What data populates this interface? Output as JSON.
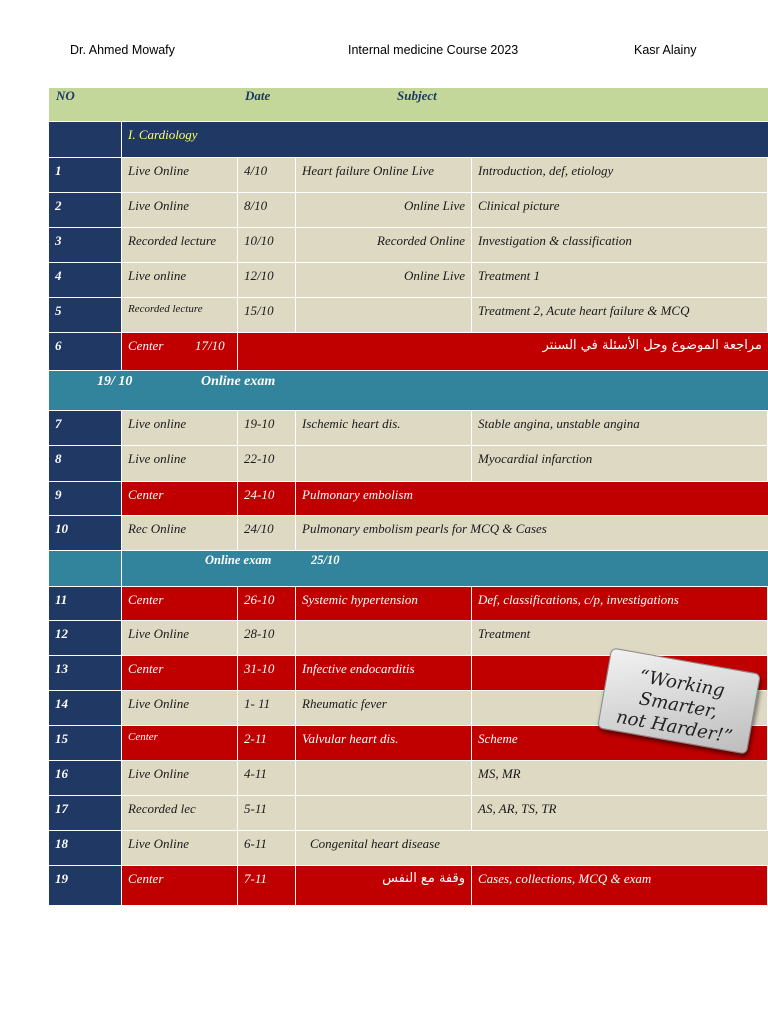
{
  "header": {
    "left": "Dr. Ahmed Mowafy",
    "center": "Internal medicine Course 2023",
    "right": "Kasr Alainy"
  },
  "table_header": {
    "no": "NO",
    "date": "Date",
    "subject": "Subject"
  },
  "cardiology_title": "I. Cardiology",
  "section1": {
    "date": "19/ 10",
    "label": "Online exam"
  },
  "section2": {
    "label": "Online exam",
    "date": "25/10"
  },
  "rows": [
    {
      "no": "1",
      "type": "Live Online",
      "date": "4/10",
      "subject": "Heart failure   Online Live",
      "desc": "Introduction, def, etiology"
    },
    {
      "no": "2",
      "type": "Live Online",
      "date": "8/10",
      "subject": "Online Live",
      "desc": "Clinical picture"
    },
    {
      "no": "3",
      "type": "Recorded lecture",
      "date": "10/10",
      "subject": "Recorded Online",
      "desc": "Investigation & classification"
    },
    {
      "no": "4",
      "type": "Live online",
      "date": "12/10",
      "subject": "Online Live",
      "desc": "Treatment 1"
    },
    {
      "no": "5",
      "type": "Recorded lecture",
      "date": "15/10",
      "subject": "",
      "desc": "Treatment 2, Acute heart failure & MCQ"
    },
    {
      "no": "6",
      "type": "Center",
      "date": "17/10",
      "subject": "مراجعة الموضوع وحل الأسئلة في السنتر",
      "desc": ""
    },
    {
      "no": "7",
      "type": "Live online",
      "date": "19-10",
      "subject": "Ischemic heart dis.",
      "desc": "Stable angina, unstable angina"
    },
    {
      "no": "8",
      "type": "Live online",
      "date": "22-10",
      "subject": "",
      "desc": "Myocardial infarction"
    },
    {
      "no": "9",
      "type": "Center",
      "date": "24-10",
      "subject": "Pulmonary embolism",
      "desc": ""
    },
    {
      "no": "10",
      "type": "Rec Online",
      "date": "24/10",
      "subject": "Pulmonary embolism pearls for MCQ & Cases",
      "desc": ""
    },
    {
      "no": "11",
      "type": "Center",
      "date": "26-10",
      "subject": "Systemic hypertension",
      "desc": "Def, classifications, c/p, investigations"
    },
    {
      "no": "12",
      "type": "Live Online",
      "date": "28-10",
      "subject": "",
      "desc": "Treatment"
    },
    {
      "no": "13",
      "type": "Center",
      "date": "31-10",
      "subject": "Infective endocarditis",
      "desc": ""
    },
    {
      "no": "14",
      "type": "Live Online",
      "date": "1- 11",
      "subject": "Rheumatic fever",
      "desc": ""
    },
    {
      "no": "15",
      "type": "Center",
      "date": "2-11",
      "subject": "Valvular heart dis.",
      "desc": "Scheme"
    },
    {
      "no": "16",
      "type": "Live Online",
      "date": "4-11",
      "subject": "",
      "desc": "MS, MR"
    },
    {
      "no": "17",
      "type": "Recorded lec",
      "date": "5-11",
      "subject": "",
      "desc": "AS, AR, TS, TR"
    },
    {
      "no": "18",
      "type": "Live Online",
      "date": "6-11",
      "subject": "Congenital heart disease",
      "desc": ""
    },
    {
      "no": "19",
      "type": "Center",
      "date": "7-11",
      "subject": "وقفة مع النفس",
      "desc": "Cases, collections, MCQ & exam"
    }
  ],
  "badge": {
    "line1": "“Working Smarter,",
    "line2": "not Harder!”"
  }
}
